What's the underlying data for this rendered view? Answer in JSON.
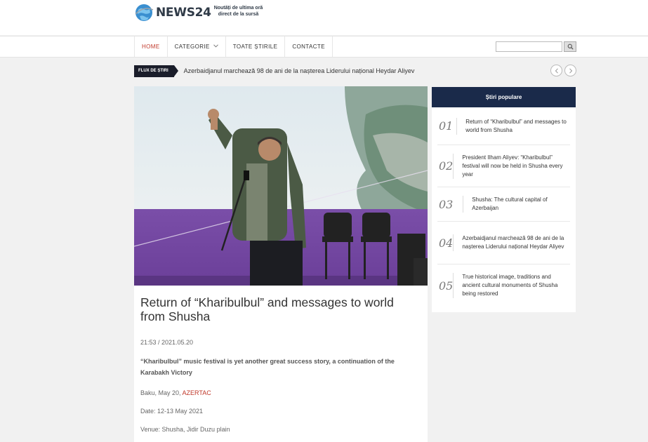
{
  "header": {
    "logo_name": "NEWS24",
    "logo_tagline_line1": "Noutăți de ultima oră",
    "logo_tagline_line2": "direct de la sursă"
  },
  "nav": {
    "items": [
      {
        "label": "HOME",
        "active": true
      },
      {
        "label": "CATEGORIE",
        "has_dropdown": true
      },
      {
        "label": "TOATE ȘTIRILE"
      },
      {
        "label": "CONTACTE"
      }
    ],
    "search": {
      "placeholder": "",
      "button_icon": "search-icon"
    }
  },
  "ticker": {
    "label": "FLUX DE ȘTIRI",
    "text": "Azerbaidjanul marchează 98 de ani de la nașterea Liderului național Heydar Aliyev",
    "prev_icon": "chevron-left-icon",
    "next_icon": "chevron-right-icon"
  },
  "article": {
    "title": "Return of “Kharibulbul” and messages to world from Shusha",
    "datetime": "21:53 / 2021.05.20",
    "lead": "“Kharibulbul” music festival is yet another great success story, a continuation of the Karabakh Victory",
    "dateline_prefix": "Baku, May 20, ",
    "dateline_source": "AZERTAC",
    "date_line": "Date: 12-13 May 2021",
    "venue_line": "Venue: Shusha, Jidir Duzu plain"
  },
  "sidebar": {
    "title": "Știri populare",
    "items": [
      {
        "num": "01",
        "title": "Return of “Kharibulbul” and messages to world from Shusha"
      },
      {
        "num": "02",
        "title": "President Ilham Aliyev: “Kharibulbul” festival will now be held in Shusha every year"
      },
      {
        "num": "03",
        "title": "Shusha: The cultural capital of Azerbaijan"
      },
      {
        "num": "04",
        "title": "Azerbaidjanul marchează 98 de ani de la nașterea Liderului național Heydar Aliyev"
      },
      {
        "num": "05",
        "title": "True historical image, traditions and ancient cultural monuments of Shusha being restored"
      }
    ]
  },
  "colors": {
    "accent_red": "#c0392b",
    "sidebar_header": "#1a2a4a",
    "ticker_label": "#1a1d2a"
  }
}
